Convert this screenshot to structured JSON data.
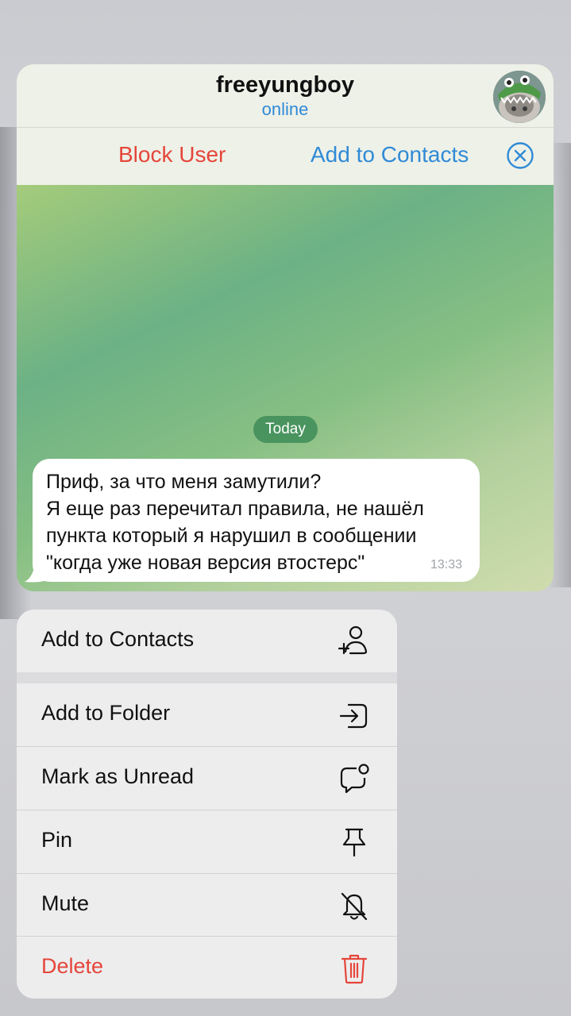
{
  "chat": {
    "title": "freeyungboy",
    "status": "online"
  },
  "action_bar": {
    "block_label": "Block User",
    "add_label": "Add to Contacts",
    "close_icon": "close-circle-icon"
  },
  "date_separator": "Today",
  "message": {
    "text": "Приф, за что меня замутили?\nЯ еще раз перечитал правила, не нашёл пункта который я нарушил в сообщении \"когда уже новая версия втостерс\"",
    "time": "13:33"
  },
  "menu": {
    "items": [
      {
        "label": "Add to Contacts",
        "icon": "add-contact-icon"
      },
      {
        "label": "Add to Folder",
        "icon": "folder-move-icon"
      },
      {
        "label": "Mark as Unread",
        "icon": "unread-bubble-icon"
      },
      {
        "label": "Pin",
        "icon": "pin-icon"
      },
      {
        "label": "Mute",
        "icon": "bell-muted-icon"
      },
      {
        "label": "Delete",
        "icon": "trash-icon"
      }
    ]
  },
  "colors": {
    "accent_blue": "#2f8ad6",
    "destructive_red": "#e5463a",
    "date_pill": "#3e8c58"
  }
}
